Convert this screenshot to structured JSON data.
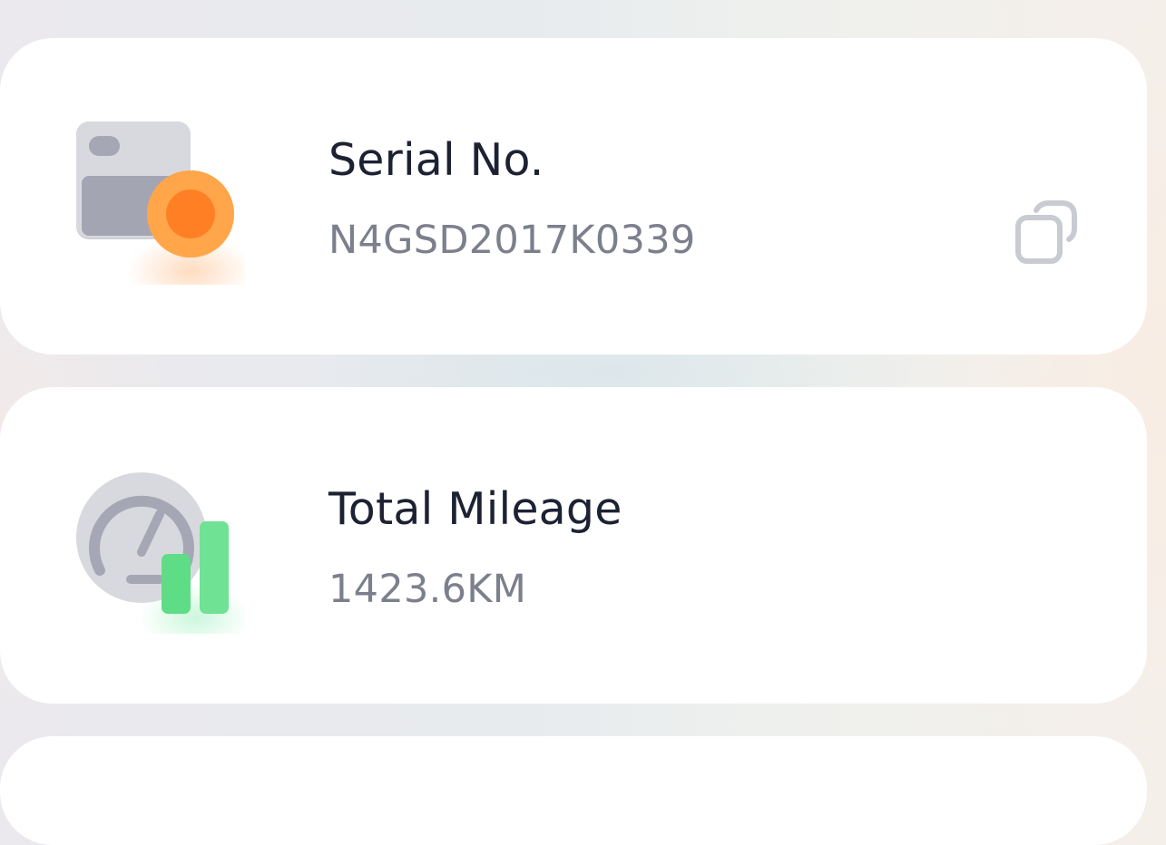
{
  "items": [
    {
      "title": "Serial No.",
      "value": "N4GSD2017K0339",
      "icon": "serial-card-icon",
      "action_icon": "copy-icon"
    },
    {
      "title": "Total Mileage",
      "value": "1423.6KM",
      "icon": "odometer-icon"
    }
  ],
  "colors": {
    "title": "#1d2233",
    "value": "#7c7f8c",
    "accent_orange": "#ff8a2a",
    "accent_green": "#5fdc86",
    "icon_gray": "#c9cbd2"
  }
}
